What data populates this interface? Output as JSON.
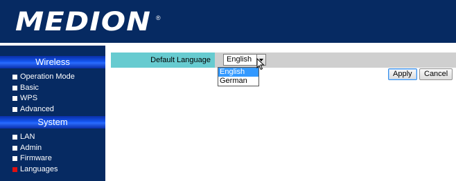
{
  "header": {
    "brand": "MEDION",
    "registered_mark": "®"
  },
  "sidebar": {
    "sections": [
      {
        "title": "Wireless",
        "items": [
          {
            "label": "Operation Mode",
            "active": false
          },
          {
            "label": "Basic",
            "active": false
          },
          {
            "label": "WPS",
            "active": false
          },
          {
            "label": "Advanced",
            "active": false
          }
        ]
      },
      {
        "title": "System",
        "items": [
          {
            "label": "LAN",
            "active": false
          },
          {
            "label": "Admin",
            "active": false
          },
          {
            "label": "Firmware",
            "active": false
          },
          {
            "label": "Languages",
            "active": true
          }
        ]
      }
    ]
  },
  "main": {
    "default_language_label": "Default Language",
    "language_select": {
      "value": "English",
      "options": [
        "English",
        "German"
      ],
      "highlighted": "English"
    },
    "apply_label": "Apply",
    "cancel_label": "Cancel"
  },
  "colors": {
    "header_bg": "#062a62",
    "label_cell_bg": "#67cbd0",
    "active_bullet": "#e01010",
    "option_highlight": "#3399ff"
  }
}
